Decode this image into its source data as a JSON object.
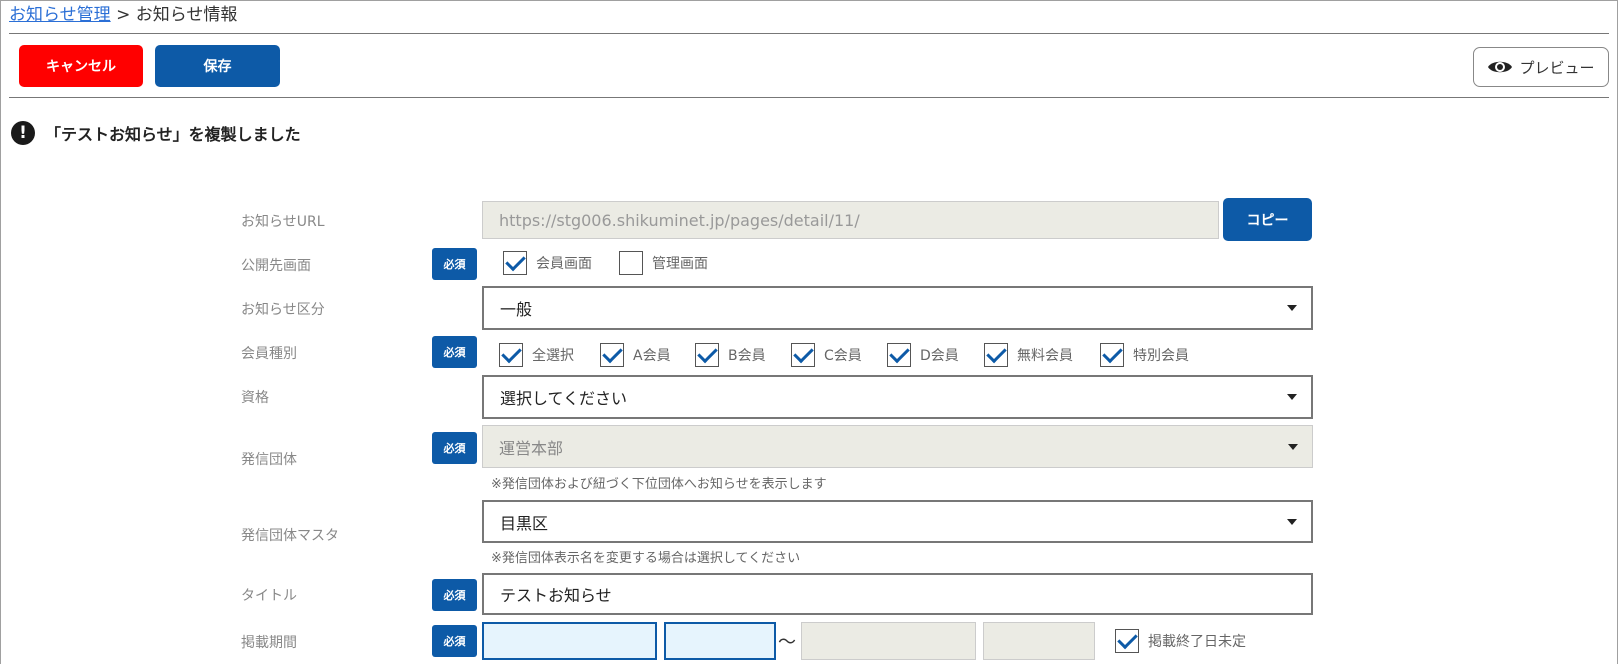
{
  "breadcrumb": {
    "link": "お知らせ管理",
    "separator": ">",
    "current": "お知らせ情報"
  },
  "toolbar": {
    "cancel_label": "キャンセル",
    "save_label": "保存",
    "preview_label": "プレビュー"
  },
  "notice": {
    "icon": "exclamation-icon",
    "icon_glyph": "!",
    "text": "「テストお知らせ」を複製しました"
  },
  "required_label": "必須",
  "form": {
    "url": {
      "label": "お知らせURL",
      "value": "https://stg006.shikuminet.jp/pages/detail/11/",
      "copy_label": "コピー"
    },
    "publish_target": {
      "label": "公開先画面",
      "options": [
        {
          "label": "会員画面",
          "checked": true
        },
        {
          "label": "管理画面",
          "checked": false
        }
      ]
    },
    "category": {
      "label": "お知らせ区分",
      "value": "一般"
    },
    "member_type": {
      "label": "会員種別",
      "options": [
        {
          "label": "全選択",
          "checked": true
        },
        {
          "label": "A会員",
          "checked": true
        },
        {
          "label": "B会員",
          "checked": true
        },
        {
          "label": "C会員",
          "checked": true
        },
        {
          "label": "D会員",
          "checked": true
        },
        {
          "label": "無料会員",
          "checked": true
        },
        {
          "label": "特別会員",
          "checked": true
        }
      ]
    },
    "qualification": {
      "label": "資格",
      "value": "選択してください"
    },
    "sender_group": {
      "label": "発信団体",
      "value": "運営本部",
      "hint": "※発信団体および紐づく下位団体へお知らせを表示します"
    },
    "sender_group_master": {
      "label": "発信団体マスタ",
      "value": "目黒区",
      "hint": "※発信団体表示名を変更する場合は選択してください"
    },
    "title": {
      "label": "タイトル",
      "value": "テストお知らせ"
    },
    "period": {
      "label": "掲載期間",
      "start_date": "",
      "start_time": "",
      "separator": "〜",
      "end_date": "",
      "end_time": "",
      "no_end_label": "掲載終了日未定",
      "no_end_checked": true
    }
  },
  "colors": {
    "primary": "#0d5aa7",
    "danger": "#ff0000",
    "link": "#2b6fd6",
    "disabled_bg": "#ebebe4",
    "active_bg": "#e6f4fd"
  }
}
